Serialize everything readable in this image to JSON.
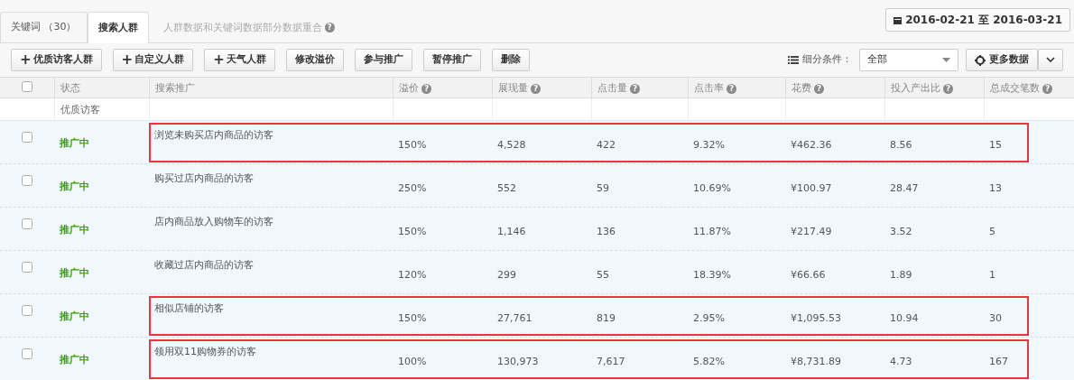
{
  "tabs": [
    {
      "label": "关键词 （30）",
      "selected": false
    },
    {
      "label": "搜索人群",
      "selected": true
    }
  ],
  "notice": {
    "text": "人群数据和关键词数据部分数据重合",
    "help": "?"
  },
  "date_range": "2016-02-21 至 2016-03-21",
  "toolbar": {
    "buttons": [
      {
        "label": "优质访客人群",
        "kind": "add",
        "plus": "+"
      },
      {
        "label": "自定义人群",
        "kind": "add",
        "plus": "+"
      },
      {
        "label": "天气人群",
        "kind": "add",
        "plus": "+"
      },
      {
        "label": "修改溢价",
        "kind": "plain"
      },
      {
        "label": "参与推广",
        "kind": "plain"
      },
      {
        "label": "暂停推广",
        "kind": "plain"
      },
      {
        "label": "删除",
        "kind": "plain"
      }
    ],
    "filter_label": "细分条件：",
    "filter_value": "全部",
    "more_data": "更多数据"
  },
  "table": {
    "header_checked": false,
    "columns": [
      {
        "label": "状态"
      },
      {
        "label": "搜索推广"
      },
      {
        "label": "溢价",
        "help": "?"
      },
      {
        "label": "展现量",
        "help": "?"
      },
      {
        "label": "点击量",
        "help": "?"
      },
      {
        "label": "点击率",
        "help": "?"
      },
      {
        "label": "花费",
        "help": "?"
      },
      {
        "label": "投入产出比",
        "help": "?"
      },
      {
        "label": "总成交笔数",
        "help": "?"
      }
    ],
    "group": "优质访客",
    "rows": [
      {
        "checked": false,
        "cells": [
          "推广中",
          "浏览未购买店内商品的访客",
          "150%",
          "4,528",
          "422",
          "9.32%",
          "¥462.36",
          "8.56",
          "15"
        ],
        "highlighted": true
      },
      {
        "checked": false,
        "cells": [
          "推广中",
          "购买过店内商品的访客",
          "250%",
          "552",
          "59",
          "10.69%",
          "¥100.97",
          "28.47",
          "13"
        ],
        "highlighted": false
      },
      {
        "checked": false,
        "cells": [
          "推广中",
          "店内商品放入购物车的访客",
          "150%",
          "1,146",
          "136",
          "11.87%",
          "¥217.49",
          "3.52",
          "5"
        ],
        "highlighted": false
      },
      {
        "checked": false,
        "cells": [
          "推广中",
          "收藏过店内商品的访客",
          "120%",
          "299",
          "55",
          "18.39%",
          "¥66.66",
          "1.89",
          "1"
        ],
        "highlighted": false
      },
      {
        "checked": false,
        "cells": [
          "推广中",
          "相似店铺的访客",
          "150%",
          "27,761",
          "819",
          "2.95%",
          "¥1,095.53",
          "10.94",
          "30"
        ],
        "highlighted": true
      },
      {
        "checked": false,
        "cells": [
          "推广中",
          "领用双11购物券的访客",
          "100%",
          "130,973",
          "7,617",
          "5.82%",
          "¥8,731.89",
          "4.73",
          "167"
        ],
        "highlighted": true
      }
    ]
  }
}
